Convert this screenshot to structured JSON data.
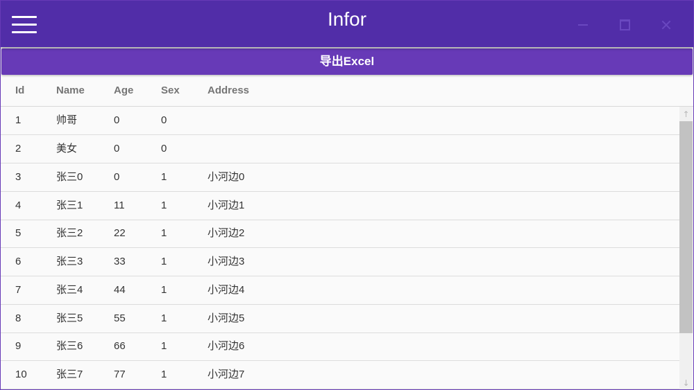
{
  "window": {
    "title": "Infor"
  },
  "toolbar": {
    "export_label": "导出Excel"
  },
  "grid": {
    "columns": [
      "Id",
      "Name",
      "Age",
      "Sex",
      "Address"
    ],
    "rows": [
      {
        "id": "1",
        "name": "帅哥",
        "age": "0",
        "sex": "0",
        "address": ""
      },
      {
        "id": "2",
        "name": "美女",
        "age": "0",
        "sex": "0",
        "address": ""
      },
      {
        "id": "3",
        "name": "张三0",
        "age": "0",
        "sex": "1",
        "address": "小河边0"
      },
      {
        "id": "4",
        "name": "张三1",
        "age": "11",
        "sex": "1",
        "address": "小河边1"
      },
      {
        "id": "5",
        "name": "张三2",
        "age": "22",
        "sex": "1",
        "address": "小河边2"
      },
      {
        "id": "6",
        "name": "张三3",
        "age": "33",
        "sex": "1",
        "address": "小河边3"
      },
      {
        "id": "7",
        "name": "张三4",
        "age": "44",
        "sex": "1",
        "address": "小河边4"
      },
      {
        "id": "8",
        "name": "张三5",
        "age": "55",
        "sex": "1",
        "address": "小河边5"
      },
      {
        "id": "9",
        "name": "张三6",
        "age": "66",
        "sex": "1",
        "address": "小河边6"
      },
      {
        "id": "10",
        "name": "张三7",
        "age": "77",
        "sex": "1",
        "address": "小河边7"
      }
    ]
  },
  "scrollbar": {
    "up_icon": "↑",
    "down_icon": "↓",
    "visible_fraction": 0.75
  },
  "colors": {
    "titlebar": "#512da8",
    "accent": "#673ab7",
    "window_controls": "#6a48c0"
  },
  "icons": {
    "menu": "hamburger-menu-icon",
    "minimize": "minimize-icon",
    "maximize": "maximize-icon",
    "close": "close-icon"
  }
}
